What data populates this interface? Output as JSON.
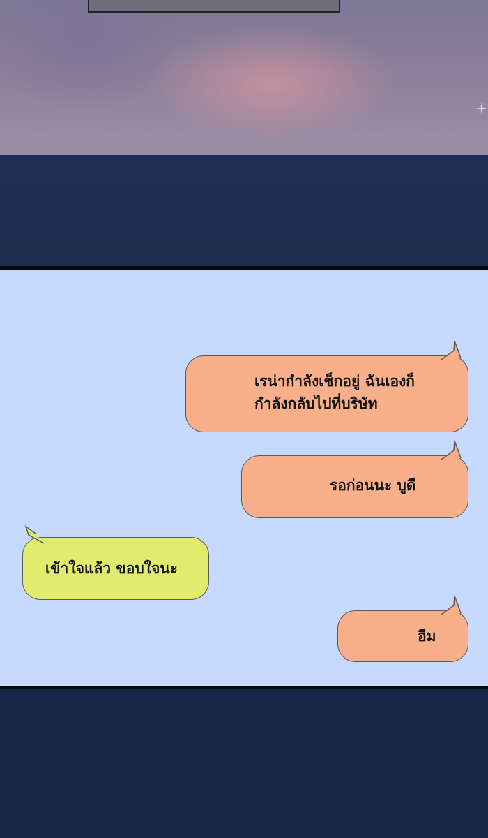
{
  "messages": [
    {
      "side": "right",
      "color": "#f8af8a",
      "lines": [
        "เรน่ากำลังเช็กอยู่ ฉันเองก็",
        "กำลังกลับไปที่บริษัท"
      ]
    },
    {
      "side": "right",
      "color": "#f8af8a",
      "lines": [
        "รอก่อนนะ บูดี"
      ]
    },
    {
      "side": "left",
      "color": "#e1ec6e",
      "lines": [
        "เข้าใจแล้ว ขอบใจนะ"
      ]
    },
    {
      "side": "right",
      "color": "#f8af8a",
      "lines": [
        "อืม"
      ]
    }
  ],
  "colors": {
    "chat_background": "#c6daff",
    "panel_gutter": "#1d2a4f",
    "outgoing_bubble": "#f8af8a",
    "incoming_bubble": "#e1ec6e"
  }
}
